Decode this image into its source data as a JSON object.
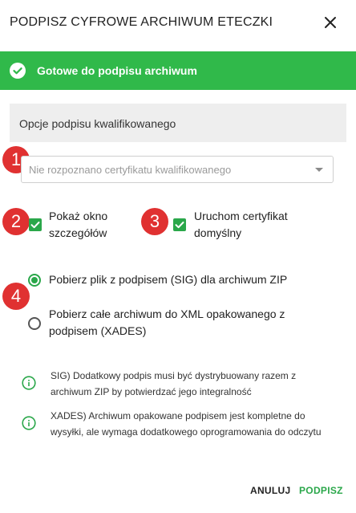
{
  "dialog": {
    "title": "PODPISZ CYFROWE ARCHIWUM ETECZKI"
  },
  "banner": {
    "text": "Gotowe do podpisu archiwum"
  },
  "section": {
    "title": "Opcje podpisu kwalifikowanego"
  },
  "markers": [
    "1",
    "2",
    "3",
    "4"
  ],
  "certificate_select": {
    "placeholder": "Nie rozpoznano certyfikatu kwalifikowanego"
  },
  "checkboxes": [
    {
      "line1": "Pokaż okno",
      "line2": "szczegółów",
      "checked": true
    },
    {
      "line1": "Uruchom certyfikat",
      "line2": "domyślny",
      "checked": true
    }
  ],
  "radios": [
    {
      "line1": "Pobierz plik z podpisem (SIG) dla archiwum ZIP",
      "line2": "",
      "selected": true
    },
    {
      "line1": "Pobierz całe archiwum do XML opakowanego z",
      "line2": "podpisem (XADES)",
      "selected": false
    }
  ],
  "info": [
    {
      "line1": "SIG) Dodatkowy podpis musi być dystrybuowany razem z",
      "line2": "archiwum ZIP by potwierdzać jego integralność"
    },
    {
      "line1": "XADES) Archiwum opakowane podpisem jest kompletne do",
      "line2": "wysyłki, ale wymaga dodatkowego oprogramowania do odczytu"
    }
  ],
  "actions": {
    "cancel": "ANULUJ",
    "sign": "PODPISZ"
  },
  "colors": {
    "accent": "#30b94a",
    "marker": "#e03131",
    "checkbox": "#2aa74a"
  }
}
